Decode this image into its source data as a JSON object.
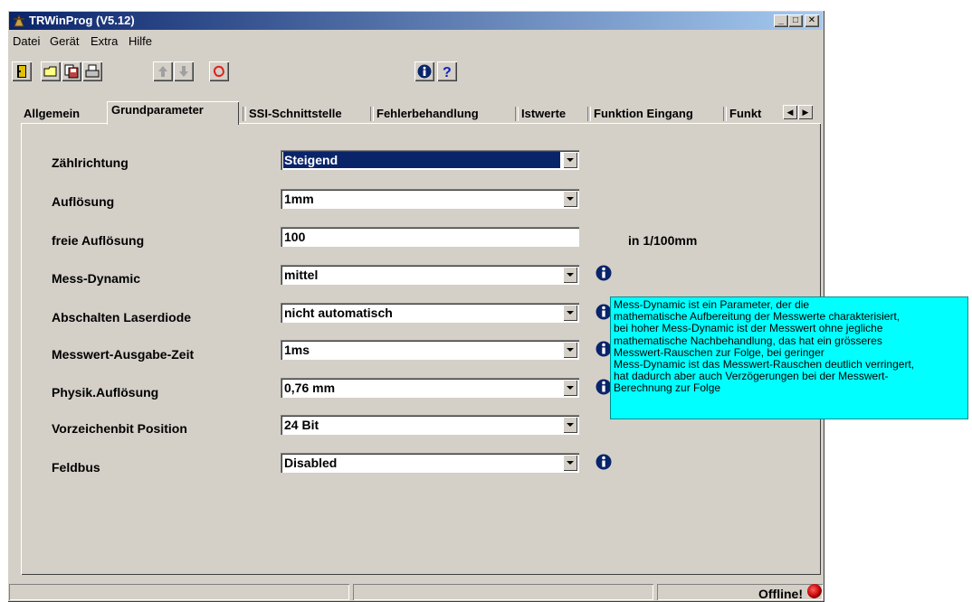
{
  "window": {
    "title": "TRWinProg  (V5.12)"
  },
  "menu": [
    "Datei",
    "Gerät",
    "Extra",
    "Hilfe"
  ],
  "toolbar": {
    "icons": [
      "exit-icon",
      "open-folder-icon",
      "save-icon",
      "print-icon",
      "arrow-up-icon",
      "arrow-down-icon",
      "refresh-icon",
      "info-icon",
      "help-icon"
    ]
  },
  "tabs": [
    "Allgemein",
    "Grundparameter",
    "SSI-Schnittstelle",
    "Fehlerbehandlung",
    "Istwerte",
    "Funktion Eingang",
    "Funkt"
  ],
  "active_tab": "Grundparameter",
  "params": [
    {
      "label": "Zählrichtung",
      "value": "Steigend",
      "type": "combo",
      "selected": true,
      "info": false
    },
    {
      "label": "Auflösung",
      "value": "1mm",
      "type": "combo",
      "info": false
    },
    {
      "label": "freie Auflösung",
      "value": "100",
      "type": "text",
      "unit": "in 1/100mm",
      "info": false
    },
    {
      "label": "Mess-Dynamic",
      "value": "mittel",
      "type": "combo",
      "info": true
    },
    {
      "label": "Abschalten Laserdiode",
      "value": "nicht automatisch",
      "type": "combo",
      "info": true
    },
    {
      "label": "Messwert-Ausgabe-Zeit",
      "value": "1ms",
      "type": "combo",
      "info": true
    },
    {
      "label": "Physik.Auflösung",
      "value": "0,76 mm",
      "type": "combo",
      "info": true
    },
    {
      "label": "Vorzeichenbit Position",
      "value": "24 Bit",
      "type": "combo",
      "info": false
    },
    {
      "label": "Feldbus",
      "value": "Disabled",
      "type": "combo",
      "info": true
    }
  ],
  "tooltip": {
    "lines": [
      "Mess-Dynamic ist ein Parameter, der die",
      "mathematische Aufbereitung der Messwerte charakterisiert,",
      "bei hoher Mess-Dynamic ist der Messwert ohne jegliche",
      "mathematische Nachbehandlung, das hat ein grösseres",
      "Messwert-Rauschen zur Folge, bei geringer",
      "Mess-Dynamic ist das Messwert-Rauschen deutlich verringert,",
      "hat dadurch aber auch Verzögerungen bei der Messwert-",
      "Berechnung zur Folge"
    ]
  },
  "status": {
    "connection": "Offline!"
  },
  "colors": {
    "title_bar": "#0a246a",
    "tooltip_bg": "#00ffff",
    "selection": "#0a246a",
    "led": "#cc0000"
  }
}
